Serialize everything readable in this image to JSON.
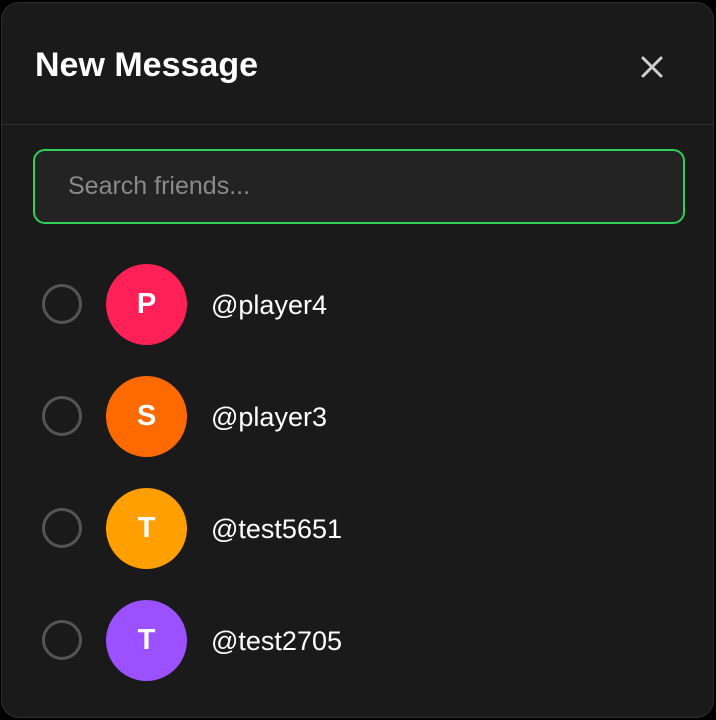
{
  "dialog": {
    "title": "New Message",
    "close_icon": "close-icon"
  },
  "search": {
    "placeholder": "Search friends...",
    "value": "",
    "accent_color": "#2fcf5a"
  },
  "friends": [
    {
      "initial": "P",
      "username": "@player4",
      "color": "#ff2057",
      "selected": false
    },
    {
      "initial": "S",
      "username": "@player3",
      "color": "#ff6a00",
      "selected": false
    },
    {
      "initial": "T",
      "username": "@test5651",
      "color": "#ff9f00",
      "selected": false
    },
    {
      "initial": "T",
      "username": "@test2705",
      "color": "#9b51ff",
      "selected": false
    }
  ]
}
